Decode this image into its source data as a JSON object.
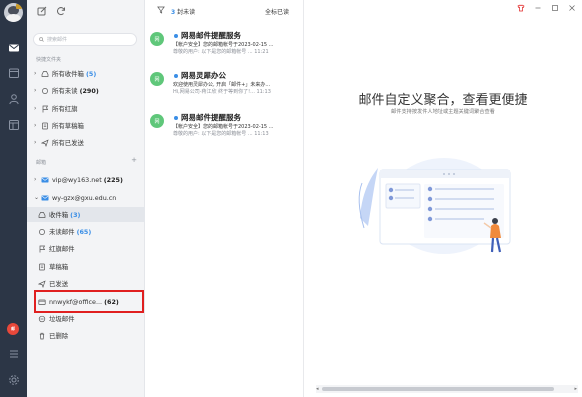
{
  "sidebar": {
    "search_placeholder": "搜索邮件",
    "quick_title": "快捷文件夹",
    "quick": [
      {
        "label": "所有收件箱",
        "count": "(5)"
      },
      {
        "label": "所有未读",
        "count": "(290)"
      },
      {
        "label": "所有红旗",
        "count": ""
      },
      {
        "label": "所有草稿箱",
        "count": ""
      },
      {
        "label": "所有已发送",
        "count": ""
      }
    ],
    "mailbox_title": "邮箱",
    "accounts": [
      {
        "label": "vip@wy163.net",
        "count": "(225)"
      },
      {
        "label": "wy-gzx@gxu.edu.cn",
        "count": ""
      }
    ],
    "folders": [
      {
        "label": "收件箱",
        "count": "(3)"
      },
      {
        "label": "未读邮件",
        "count": "(65)"
      },
      {
        "label": "红旗邮件",
        "count": ""
      },
      {
        "label": "草稿箱",
        "count": ""
      },
      {
        "label": "已发送",
        "count": ""
      },
      {
        "label": "nnwykf@office...",
        "count": "(62)"
      },
      {
        "label": "垃圾邮件",
        "count": ""
      },
      {
        "label": "已删除",
        "count": ""
      }
    ]
  },
  "list": {
    "unread_count": "3",
    "unread_suffix": "封未读",
    "mark_all_read": "全标已读",
    "mails": [
      {
        "avatar": "网",
        "from": "网易邮件提醒服务",
        "subject": "【帐户安全】您的邮箱帐号于2023-02-15 ...",
        "preview": "尊敬的用户: 以下是您的邮箱帐号 ...  11:21"
      },
      {
        "avatar": "网",
        "from": "网易灵犀办公",
        "subject": "欢迎使用灵犀办公, 开启「邮件+」未来办...",
        "preview": "Hi,网易公司-蒋江欣 终于等到你了!...  11:13"
      },
      {
        "avatar": "网",
        "from": "网易邮件提醒服务",
        "subject": "【帐户安全】您的邮箱帐号于2023-02-15 ...",
        "preview": "尊敬的用户: 以下是您的邮箱帐号 ...  11:13"
      }
    ]
  },
  "main": {
    "title": "邮件自定义聚合，查看更便捷",
    "subtitle": "邮件支持按发件人地址或主题关键词聚合查看"
  },
  "colors": {
    "accent": "#3a8ee6",
    "rail": "#2c3646",
    "highlight": "#e02020",
    "avatar_green": "#5fc77a"
  },
  "icons": [
    "compose-icon",
    "refresh-icon",
    "search-icon",
    "mail-icon",
    "calendar-icon",
    "contacts-icon",
    "notes-icon",
    "grid-icon",
    "settings-icon",
    "filter-icon",
    "minimize-icon",
    "maximize-icon",
    "close-icon"
  ]
}
